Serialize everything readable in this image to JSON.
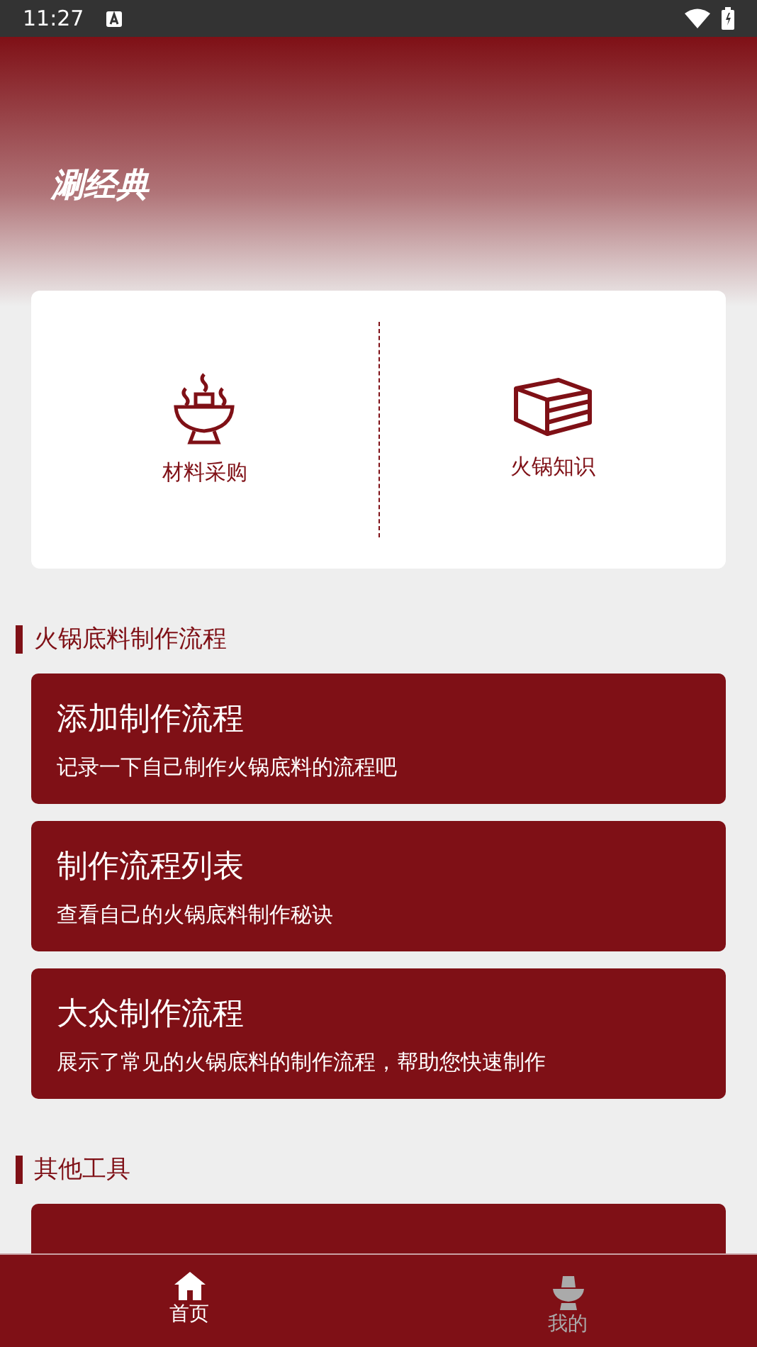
{
  "status_bar": {
    "time": "11:27"
  },
  "header": {
    "title": "涮经典"
  },
  "shortcuts": [
    {
      "kind": "hotpot",
      "label": "材料采购"
    },
    {
      "kind": "books",
      "label": "火锅知识"
    }
  ],
  "sections": [
    {
      "title": "火锅底料制作流程",
      "cards": [
        {
          "title": "添加制作流程",
          "subtitle": "记录一下自己制作火锅底料的流程吧"
        },
        {
          "title": "制作流程列表",
          "subtitle": "查看自己的火锅底料制作秘诀"
        },
        {
          "title": "大众制作流程",
          "subtitle": "展示了常见的火锅底料的制作流程，帮助您快速制作"
        }
      ]
    },
    {
      "title": "其他工具",
      "cards": [
        {
          "partial": true
        }
      ]
    }
  ],
  "bottom_nav": [
    {
      "kind": "home",
      "label": "首页",
      "selected": true
    },
    {
      "kind": "pot",
      "label": "我的",
      "selected": false
    }
  ]
}
